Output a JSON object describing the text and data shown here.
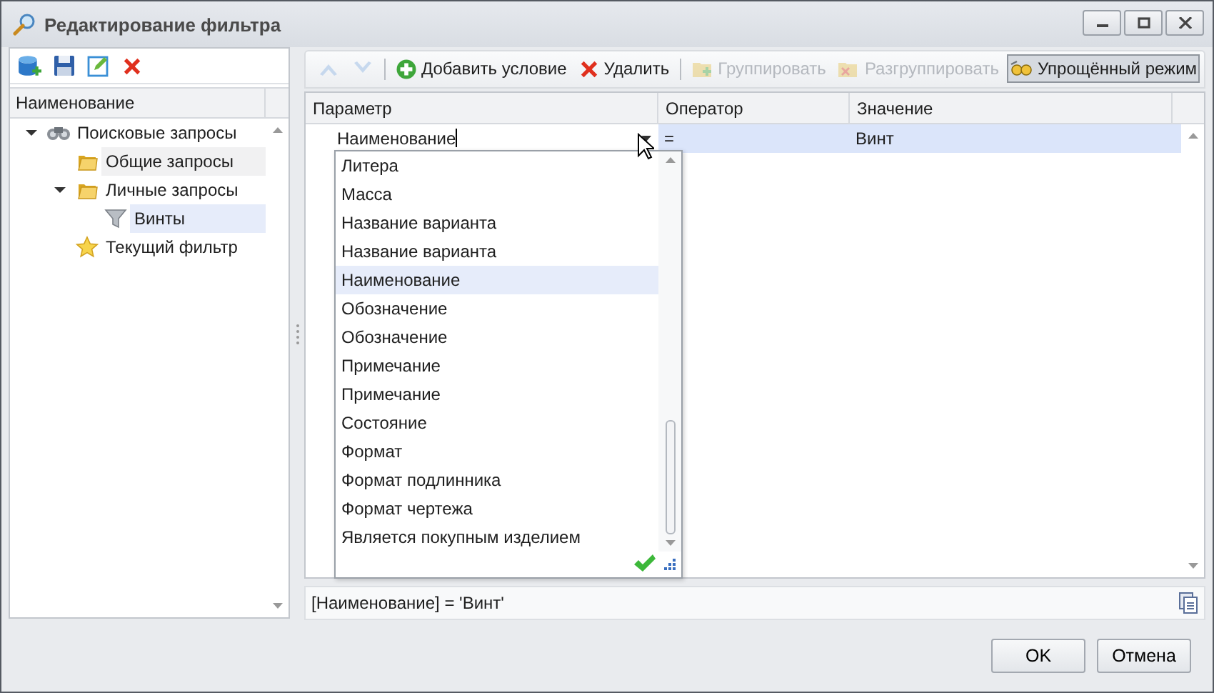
{
  "window": {
    "title": "Редактирование фильтра"
  },
  "tree": {
    "column": "Наименование",
    "items": [
      {
        "label": "Поисковые запросы",
        "kind": "search",
        "expanded": true,
        "selected": false,
        "hovered": false,
        "children": [
          {
            "label": "Общие запросы",
            "kind": "folder",
            "selected": false,
            "hovered": true
          },
          {
            "label": "Личные запросы",
            "kind": "folder",
            "expanded": true,
            "selected": false,
            "hovered": false,
            "children": [
              {
                "label": "Винты",
                "kind": "filter",
                "selected": true,
                "hovered": false
              }
            ]
          },
          {
            "label": "Текущий фильтр",
            "kind": "star",
            "selected": false,
            "hovered": false
          }
        ]
      }
    ]
  },
  "toolbar": [
    {
      "kind": "up",
      "disabled": true
    },
    {
      "kind": "down",
      "disabled": true
    },
    {
      "kind": "separator"
    },
    {
      "kind": "add",
      "label": "Добавить условие",
      "disabled": false,
      "pressed": false
    },
    {
      "kind": "delete",
      "label": "Удалить",
      "disabled": false,
      "pressed": false
    },
    {
      "kind": "separator"
    },
    {
      "kind": "group",
      "label": "Группировать",
      "disabled": true,
      "pressed": false
    },
    {
      "kind": "ungroup",
      "label": "Разгруппировать",
      "disabled": true,
      "pressed": false
    },
    {
      "kind": "simple",
      "label": "Упрощённый режим",
      "disabled": false,
      "pressed": true
    }
  ],
  "grid": {
    "columns": [
      "Параметр",
      "Оператор",
      "Значение"
    ],
    "rows": [
      {
        "cells": [
          "Наименование",
          "=",
          "Винт"
        ],
        "selected": true
      }
    ]
  },
  "dropdown": {
    "items": [
      {
        "label": "Литера",
        "selected": false
      },
      {
        "label": "Масса",
        "selected": false
      },
      {
        "label": "Название варианта",
        "selected": false
      },
      {
        "label": "Название варианта",
        "selected": false
      },
      {
        "label": "Наименование",
        "selected": true
      },
      {
        "label": "Обозначение",
        "selected": false
      },
      {
        "label": "Обозначение",
        "selected": false
      },
      {
        "label": "Примечание",
        "selected": false
      },
      {
        "label": "Примечание",
        "selected": false
      },
      {
        "label": "Состояние",
        "selected": false
      },
      {
        "label": "Формат",
        "selected": false
      },
      {
        "label": "Формат подлинника",
        "selected": false
      },
      {
        "label": "Формат чертежа",
        "selected": false
      },
      {
        "label": "Является покупным изделием",
        "selected": false
      }
    ]
  },
  "expression": "[Наименование] = 'Винт'",
  "buttons": [
    "OK",
    "Отмена"
  ]
}
